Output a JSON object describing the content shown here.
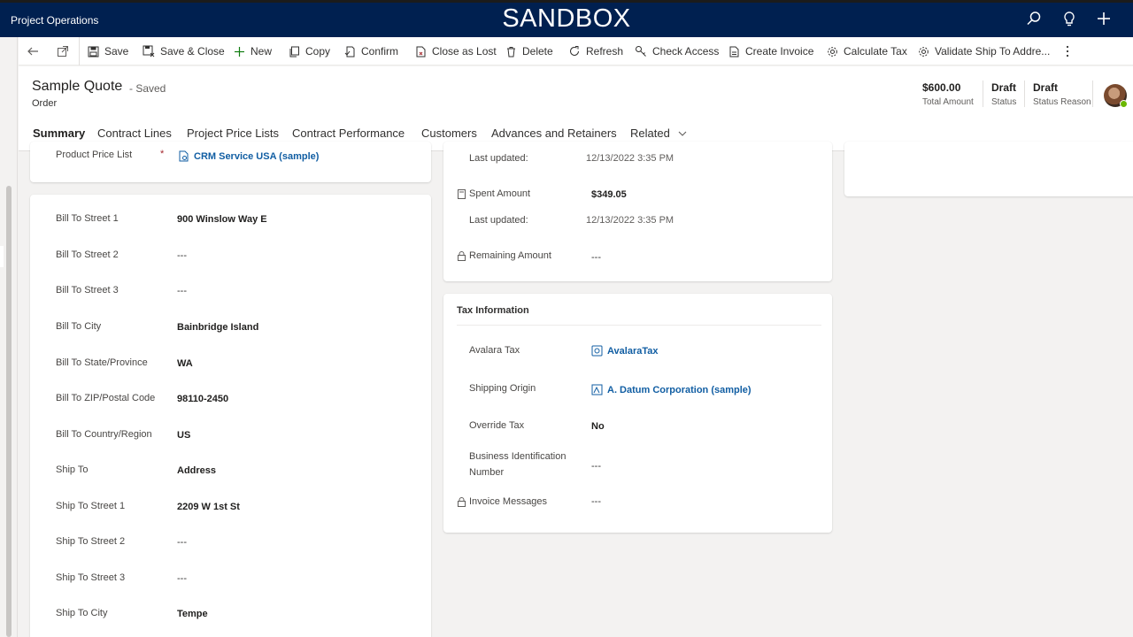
{
  "topbar": {
    "app_name": "Project Operations",
    "environment": "SANDBOX"
  },
  "commands": [
    {
      "label": "Save",
      "icon": "save-icon"
    },
    {
      "label": "Save & Close",
      "icon": "save-close-icon"
    },
    {
      "label": "New",
      "icon": "plus-icon"
    },
    {
      "label": "Copy",
      "icon": "copy-icon"
    },
    {
      "label": "Confirm",
      "icon": "confirm-icon"
    },
    {
      "label": "Close as Lost",
      "icon": "close-lost-icon"
    },
    {
      "label": "Delete",
      "icon": "trash-icon"
    },
    {
      "label": "Refresh",
      "icon": "refresh-icon"
    },
    {
      "label": "Check Access",
      "icon": "key-icon"
    },
    {
      "label": "Create Invoice",
      "icon": "document-icon"
    },
    {
      "label": "Calculate Tax",
      "icon": "gear-icon"
    },
    {
      "label": "Validate Ship To Addre...",
      "icon": "gear-icon"
    }
  ],
  "header": {
    "title": "Sample Quote",
    "saved_status": "- Saved",
    "entity_type": "Order",
    "fields": [
      {
        "value": "$600.00",
        "label": "Total Amount"
      },
      {
        "value": "Draft",
        "label": "Status"
      },
      {
        "value": "Draft",
        "label": "Status Reason"
      }
    ]
  },
  "tabs": [
    "Summary",
    "Contract Lines",
    "Project Price Lists",
    "Contract Performance",
    "Customers",
    "Advances and Retainers",
    "Related"
  ],
  "pricing_section": {
    "label": "Product Price List",
    "required_marker": "*",
    "value": "CRM Service USA (sample)"
  },
  "address_section": {
    "fields": [
      {
        "label": "Bill To Street 1",
        "value": "900 Winslow Way E"
      },
      {
        "label": "Bill To Street 2",
        "value": "---"
      },
      {
        "label": "Bill To Street 3",
        "value": "---"
      },
      {
        "label": "Bill To City",
        "value": "Bainbridge Island"
      },
      {
        "label": "Bill To State/Province",
        "value": "WA"
      },
      {
        "label": "Bill To ZIP/Postal Code",
        "value": "98110-2450"
      },
      {
        "label": "Bill To Country/Region",
        "value": "US"
      },
      {
        "label": "Ship To",
        "value": "Address"
      },
      {
        "label": "Ship To Street 1",
        "value": "2209 W 1st St"
      },
      {
        "label": "Ship To Street 2",
        "value": "---"
      },
      {
        "label": "Ship To Street 3",
        "value": "---"
      },
      {
        "label": "Ship To City",
        "value": "Tempe"
      }
    ]
  },
  "amounts_section": {
    "last_updated_1_label": "Last updated:",
    "last_updated_1_value": "12/13/2022 3:35 PM",
    "spent_label": "Spent Amount",
    "spent_value": "$349.05",
    "last_updated_2_label": "Last updated:",
    "last_updated_2_value": "12/13/2022 3:35 PM",
    "remaining_label": "Remaining Amount",
    "remaining_value": "---"
  },
  "tax_section": {
    "title": "Tax Information",
    "avalara_label": "Avalara Tax",
    "avalara_value": "AvalaraTax",
    "origin_label": "Shipping Origin",
    "origin_value": "A. Datum Corporation (sample)",
    "override_label": "Override Tax",
    "override_value": "No",
    "bin_label_line1": "Business Identification",
    "bin_label_line2": "Number",
    "bin_value": "---",
    "invoice_label": "Invoice Messages",
    "invoice_value": "---"
  },
  "colors": {
    "nav_background": "#002050",
    "link": "#115ea3",
    "required": "#a4262c",
    "add_icon": "#107c10"
  }
}
